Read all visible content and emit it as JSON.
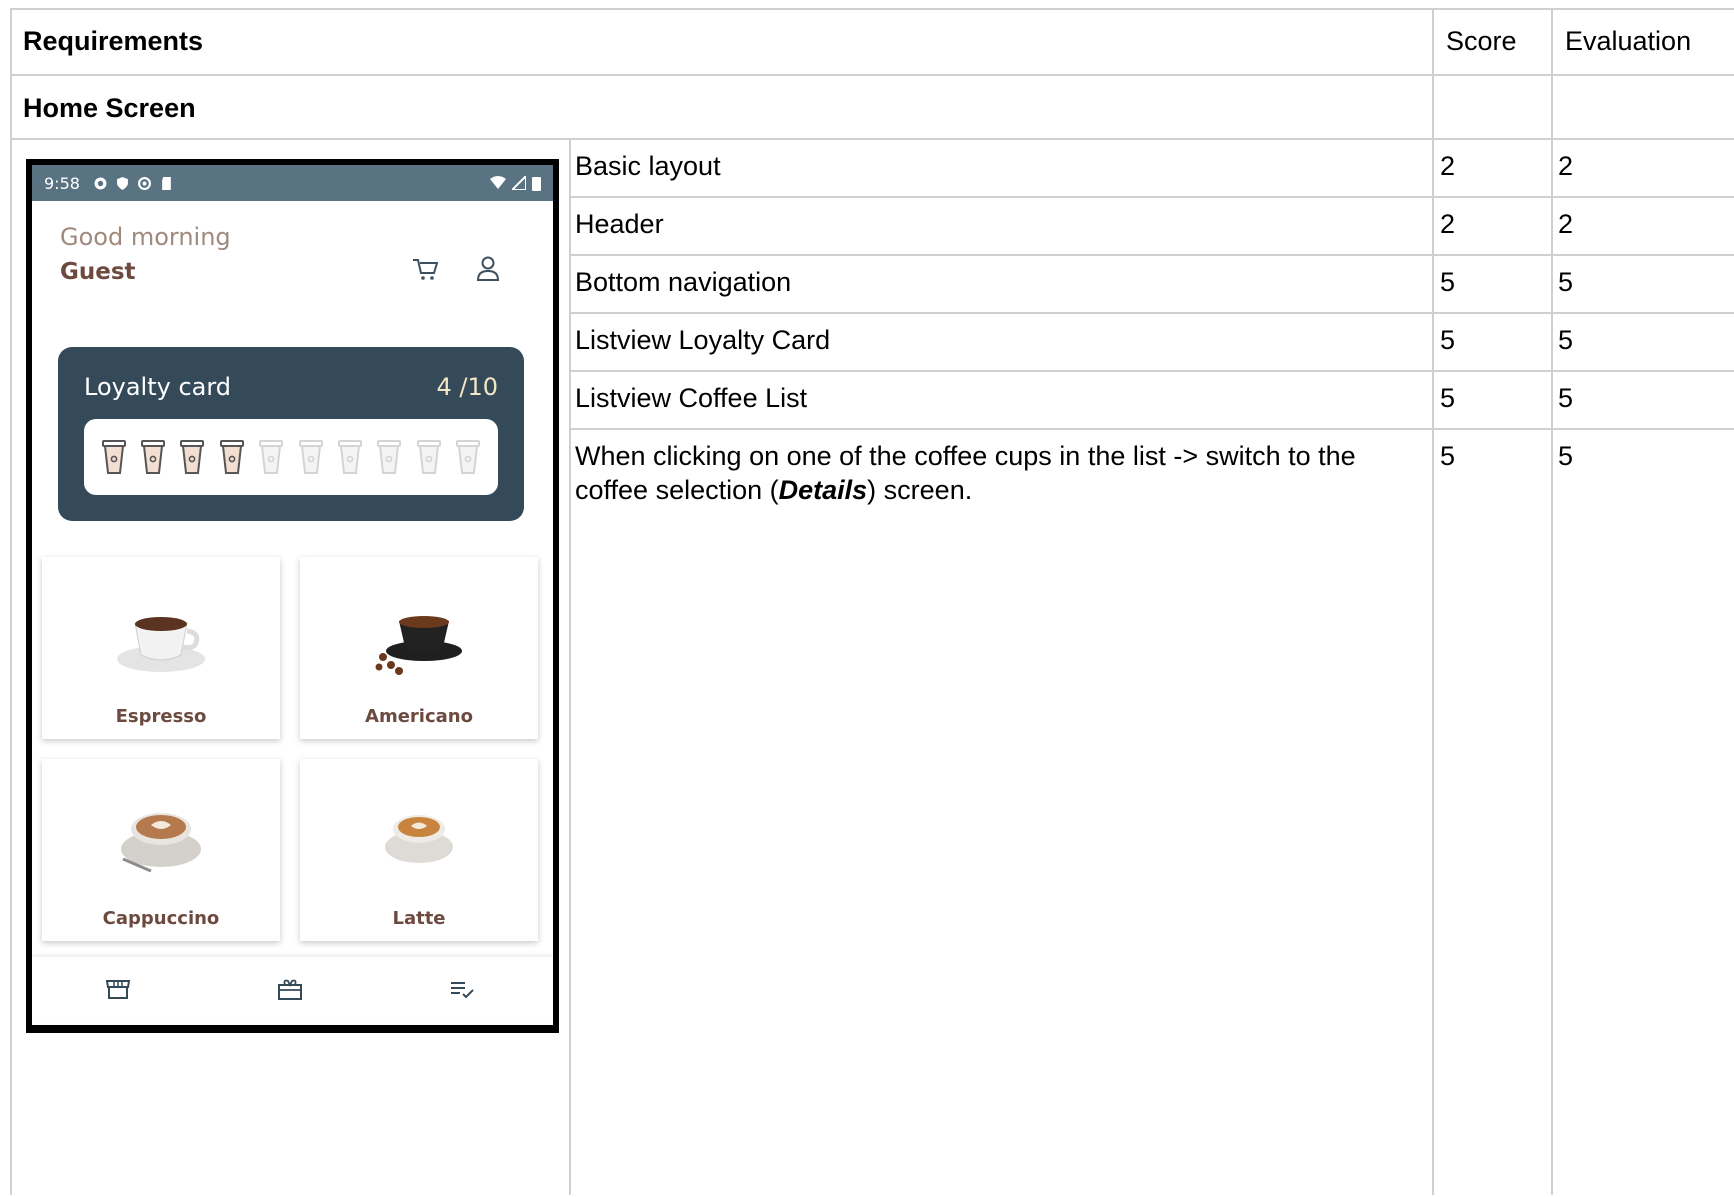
{
  "header": {
    "requirements": "Requirements",
    "score": "Score",
    "evaluation": "Evaluation"
  },
  "section": {
    "title": "Home Screen"
  },
  "rows": [
    {
      "requirement": "Basic layout",
      "score": "2",
      "evaluation": "2"
    },
    {
      "requirement": "Header",
      "score": "2",
      "evaluation": "2"
    },
    {
      "requirement": "Bottom navigation",
      "score": "5",
      "evaluation": "5"
    },
    {
      "requirement": "Listview Loyalty Card",
      "score": "5",
      "evaluation": "5"
    },
    {
      "requirement": "Listview Coffee List",
      "score": "5",
      "evaluation": "5"
    },
    {
      "requirement_prefix": "When clicking on one of the coffee cups in the list -> switch to the",
      "requirement_line2_pre": "coffee selection (",
      "requirement_emph": "Details",
      "requirement_line2_post": ") screen.",
      "score": "5",
      "evaluation": "5"
    }
  ],
  "phone": {
    "status_time": "9:58",
    "greeting": "Good morning",
    "user": "Guest",
    "loyalty": {
      "title": "Loyalty card",
      "count": "4 /10",
      "filled": 4,
      "total": 10
    },
    "coffees": [
      "Espresso",
      "Americano",
      "Cappuccino",
      "Latte"
    ],
    "nav_icons": [
      "store-icon",
      "gift-icon",
      "order-list-icon"
    ],
    "colors": {
      "statusbar": "#597382",
      "card": "#354a59",
      "brown": "#6d4a3f"
    }
  }
}
